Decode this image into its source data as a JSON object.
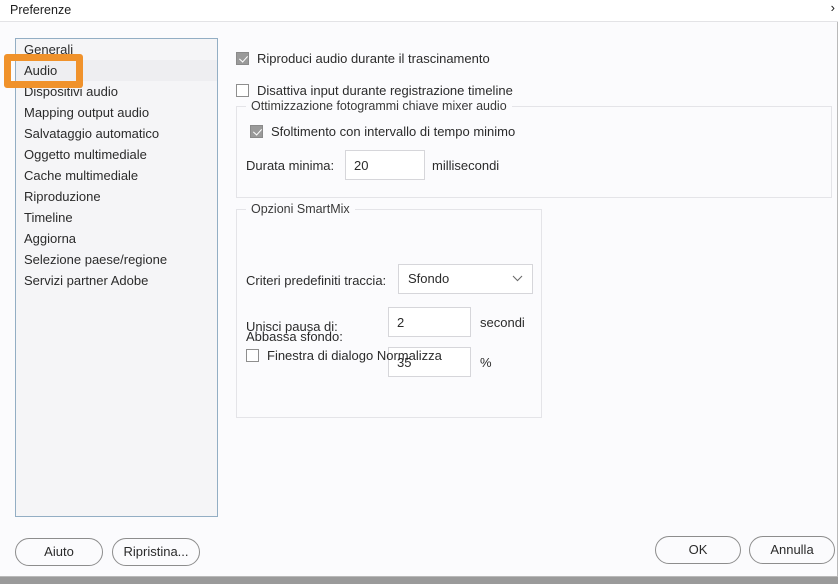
{
  "window": {
    "title": "Preferenze",
    "titlebar_icon": "chevron-right-icon"
  },
  "sidebar": {
    "items": [
      {
        "label": "Generali",
        "selected": false
      },
      {
        "label": "Audio",
        "selected": true
      },
      {
        "label": "Dispositivi audio",
        "selected": false
      },
      {
        "label": "Mapping output audio",
        "selected": false
      },
      {
        "label": "Salvataggio automatico",
        "selected": false
      },
      {
        "label": "Oggetto multimediale",
        "selected": false
      },
      {
        "label": "Cache multimediale",
        "selected": false
      },
      {
        "label": "Riproduzione",
        "selected": false
      },
      {
        "label": "Timeline",
        "selected": false
      },
      {
        "label": "Aggiorna",
        "selected": false
      },
      {
        "label": "Selezione paese/regione",
        "selected": false
      },
      {
        "label": "Servizi partner Adobe",
        "selected": false
      }
    ],
    "highlight_color": "#f0922b",
    "highlight_target": "Audio"
  },
  "panel": {
    "checkbox_playback_audio": {
      "label": "Riproduci audio durante il trascinamento",
      "checked": true
    },
    "checkbox_disable_input": {
      "label": "Disattiva input durante registrazione timeline",
      "checked": false
    },
    "group_optimization": {
      "legend": "Ottimizzazione fotogrammi chiave mixer audio",
      "checkbox_thinning": {
        "label": "Sfoltimento con  intervallo di tempo minimo",
        "checked": true
      },
      "min_duration_label": "Durata minima:",
      "min_duration_value": "20",
      "min_duration_unit": "millisecondi"
    },
    "group_smartmix": {
      "legend": "Opzioni SmartMix",
      "track_preset_label": "Criteri predefiniti traccia:",
      "track_preset_value": "Sfondo",
      "track_preset_icon": "chevron-down-icon",
      "merge_pause_label": "Unisci pausa di:",
      "merge_pause_value": "2",
      "merge_pause_unit": "secondi",
      "lower_background_label": "Abbassa sfondo:",
      "lower_background_value": "35",
      "lower_background_unit": "%",
      "checkbox_normalize_dialog": {
        "label": "Finestra di dialogo Normalizza",
        "checked": false
      }
    }
  },
  "footer": {
    "help_label": "Aiuto",
    "reset_label": "Ripristina...",
    "ok_label": "OK",
    "cancel_label": "Annulla"
  }
}
